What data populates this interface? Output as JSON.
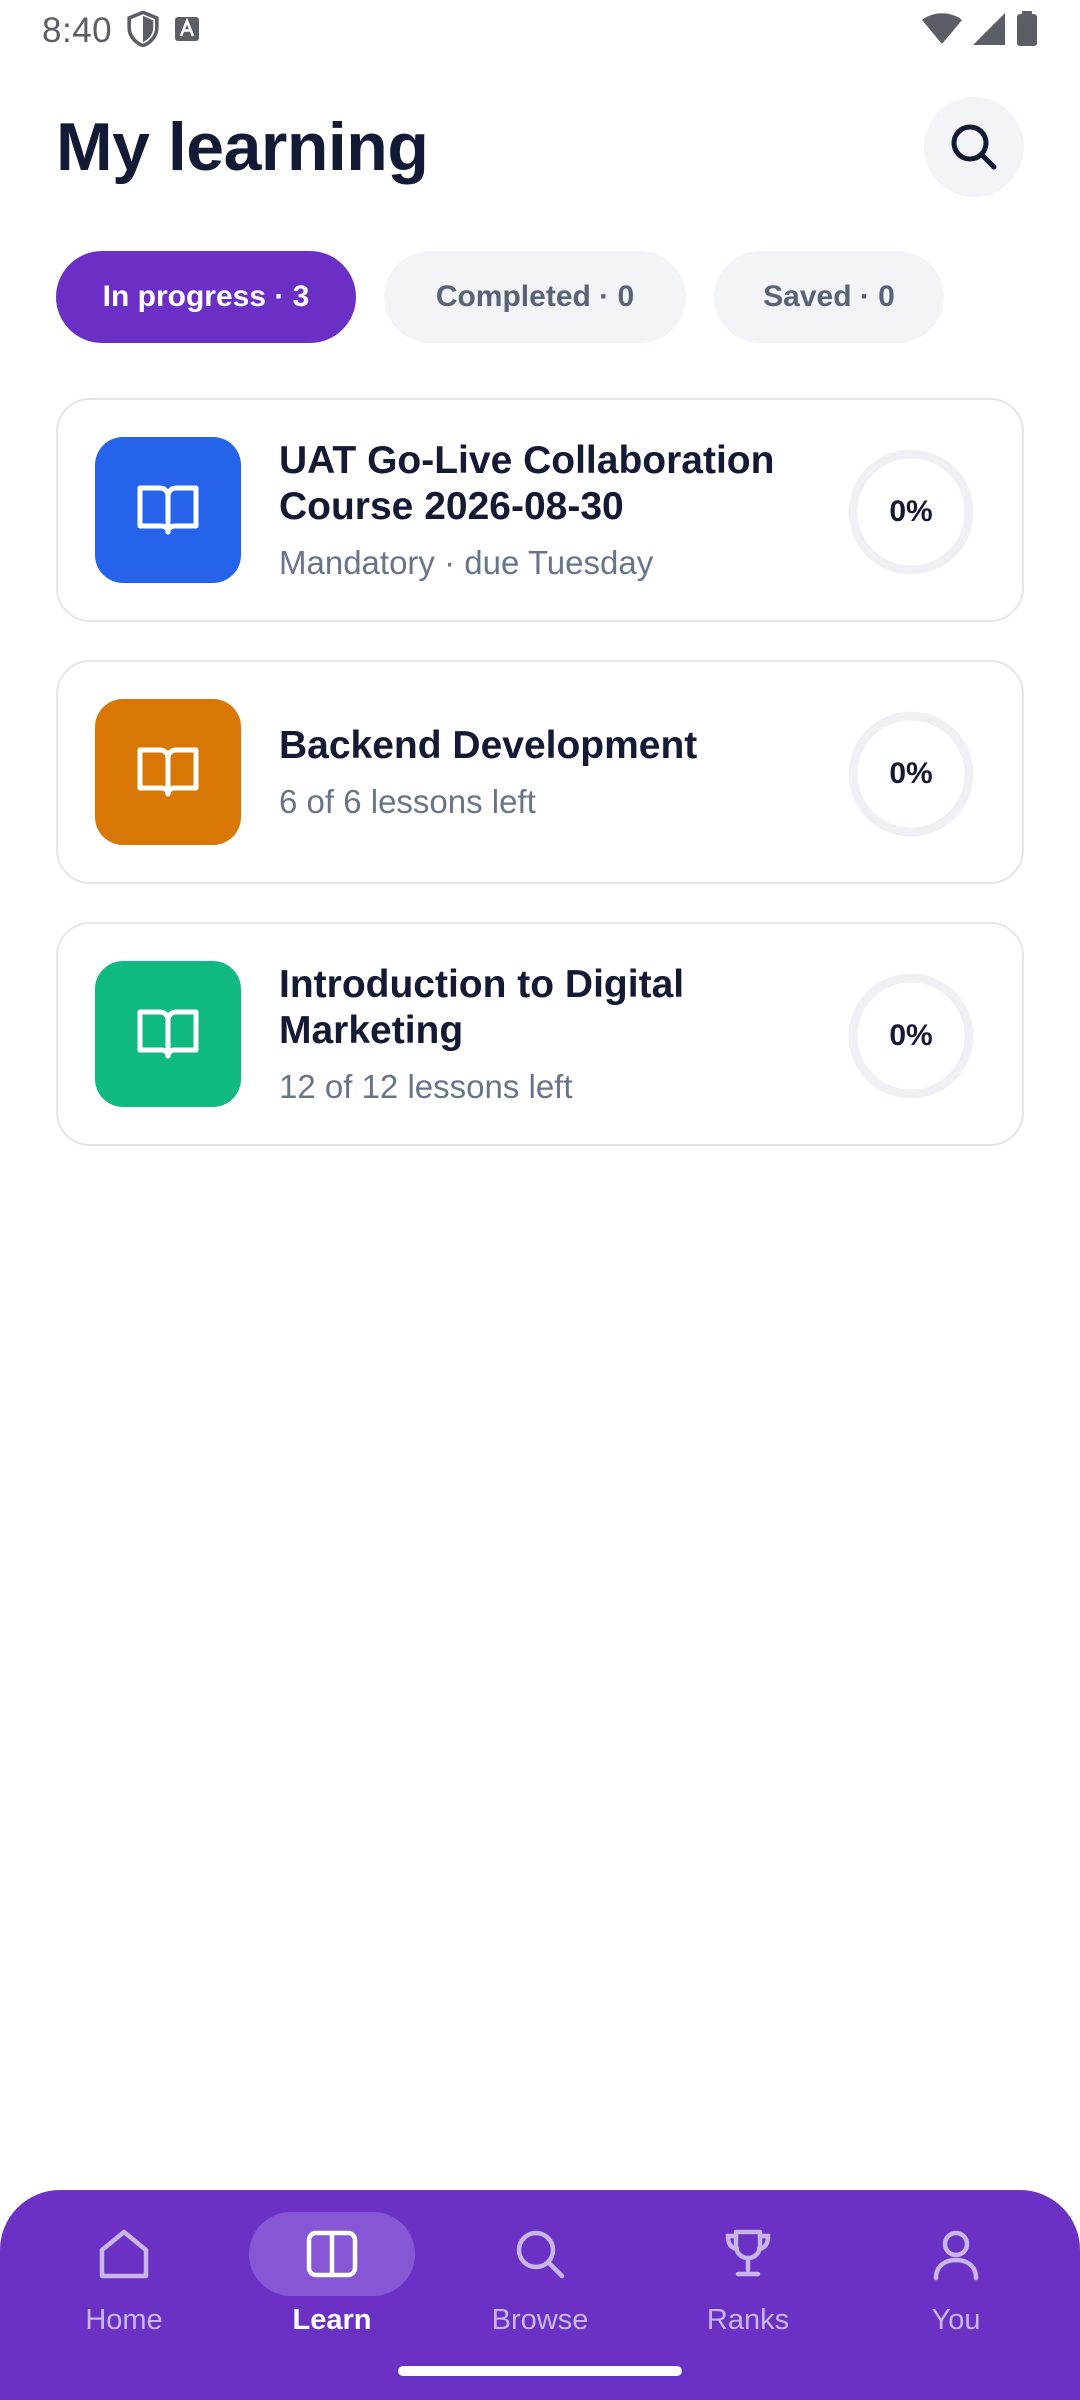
{
  "status_bar": {
    "time": "8:40",
    "icons": [
      "shield-icon",
      "font-a-icon",
      "wifi-icon",
      "signal-icon",
      "battery-icon"
    ]
  },
  "header": {
    "title": "My learning",
    "search_icon": "search-icon"
  },
  "tabs": [
    {
      "label": "In progress · 3",
      "active": true
    },
    {
      "label": "Completed · 0",
      "active": false
    },
    {
      "label": "Saved · 0",
      "active": false
    }
  ],
  "courses": [
    {
      "title": "UAT Go-Live Collaboration Course 2026-08-30",
      "meta": "Mandatory · due Tuesday",
      "progress_label": "0%",
      "progress": 0,
      "icon": "book-open-icon",
      "color": "#2563eb"
    },
    {
      "title": "Backend Development",
      "meta": "6 of 6 lessons left",
      "progress_label": "0%",
      "progress": 0,
      "icon": "book-open-icon",
      "color": "#d97706"
    },
    {
      "title": "Introduction to Digital Marketing",
      "meta": "12 of 12 lessons left",
      "progress_label": "0%",
      "progress": 0,
      "icon": "book-open-icon",
      "color": "#10b981"
    }
  ],
  "bottom_nav": [
    {
      "label": "Home",
      "icon": "home-icon",
      "active": false
    },
    {
      "label": "Learn",
      "icon": "learn-book-icon",
      "active": true
    },
    {
      "label": "Browse",
      "icon": "search-icon",
      "active": false
    },
    {
      "label": "Ranks",
      "icon": "trophy-icon",
      "active": false
    },
    {
      "label": "You",
      "icon": "user-icon",
      "active": false
    }
  ],
  "colors": {
    "accent": "#6c2fc6",
    "nav_background": "#6a31c4",
    "nav_active_pill": "#8656d4"
  }
}
